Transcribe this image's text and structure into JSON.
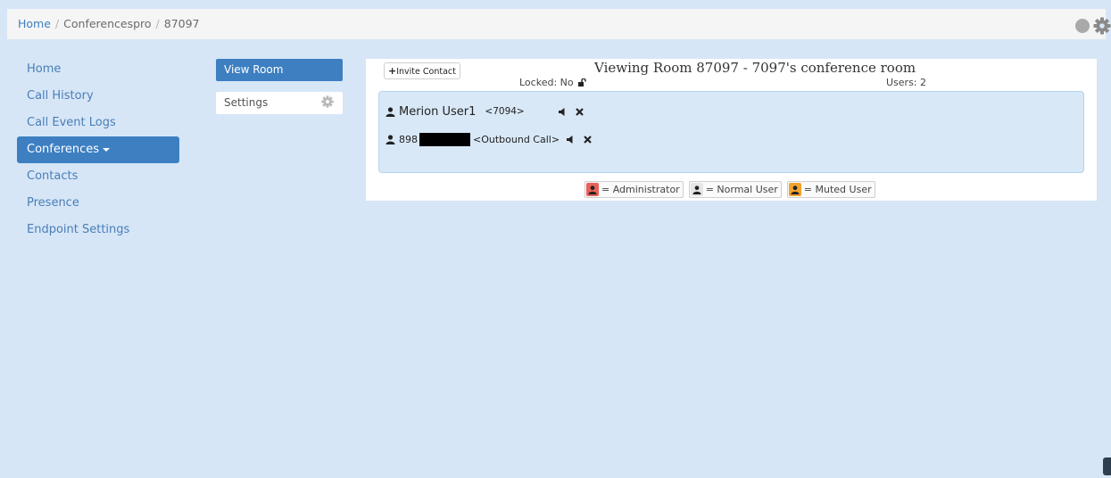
{
  "breadcrumb": {
    "home": "Home",
    "section": "Conferencespro",
    "current": "87097",
    "separator": "/"
  },
  "sidebar": {
    "items": [
      {
        "label": "Home"
      },
      {
        "label": "Call History"
      },
      {
        "label": "Call Event Logs"
      },
      {
        "label": "Conferences",
        "active": true,
        "has_caret": true
      },
      {
        "label": "Contacts"
      },
      {
        "label": "Presence"
      },
      {
        "label": "Endpoint Settings"
      }
    ]
  },
  "subnav": {
    "view_room": "View Room",
    "settings": "Settings"
  },
  "room": {
    "invite_label": "Invite Contact",
    "title": "Viewing Room 87097 - 7097's conference room",
    "locked": "Locked: No",
    "users": "Users: 2"
  },
  "members": [
    {
      "name": "Merion User1",
      "ext": "<7094>"
    },
    {
      "name": "898",
      "ext": "<Outbound Call>",
      "redacted": true
    }
  ],
  "legend": [
    {
      "label": "= Administrator",
      "color": "#e8625a"
    },
    {
      "label": "= Normal User",
      "color": "#e6e6e6"
    },
    {
      "label": "= Muted User",
      "color": "#f0a32e"
    }
  ],
  "icons": {
    "status": "status-dot",
    "settings": "gear-icon",
    "user": "user-icon",
    "volume": "volume-icon",
    "remove": "close-icon",
    "lock": "unlock-icon"
  },
  "colors": {
    "accent": "#3d7fc1",
    "background": "#d6e6f7",
    "panel_inner": "#d8e8f7"
  }
}
